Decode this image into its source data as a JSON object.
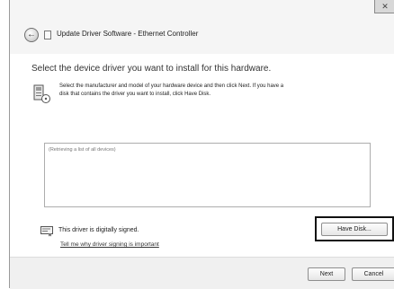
{
  "window": {
    "title": "Update Driver Software - Ethernet Controller",
    "close_label": "✕"
  },
  "content": {
    "heading": "Select the device driver you want to install for this hardware.",
    "info_line1": "Select the manufacturer and model of your hardware device and then click Next. If you have a",
    "info_line2": "disk that contains the driver you want to install, click Have Disk.",
    "list_placeholder": "(Retrieving a list of all devices)",
    "signed_text": "This driver is digitally signed.",
    "signing_link": "Tell me why driver signing is important",
    "have_disk_label": "Have Disk..."
  },
  "footer": {
    "next_label": "Next",
    "cancel_label": "Cancel"
  },
  "icons": {
    "back": "back-arrow-icon",
    "window": "driver-window-icon",
    "info": "hardware-disk-icon",
    "signed": "signed-certificate-icon"
  }
}
